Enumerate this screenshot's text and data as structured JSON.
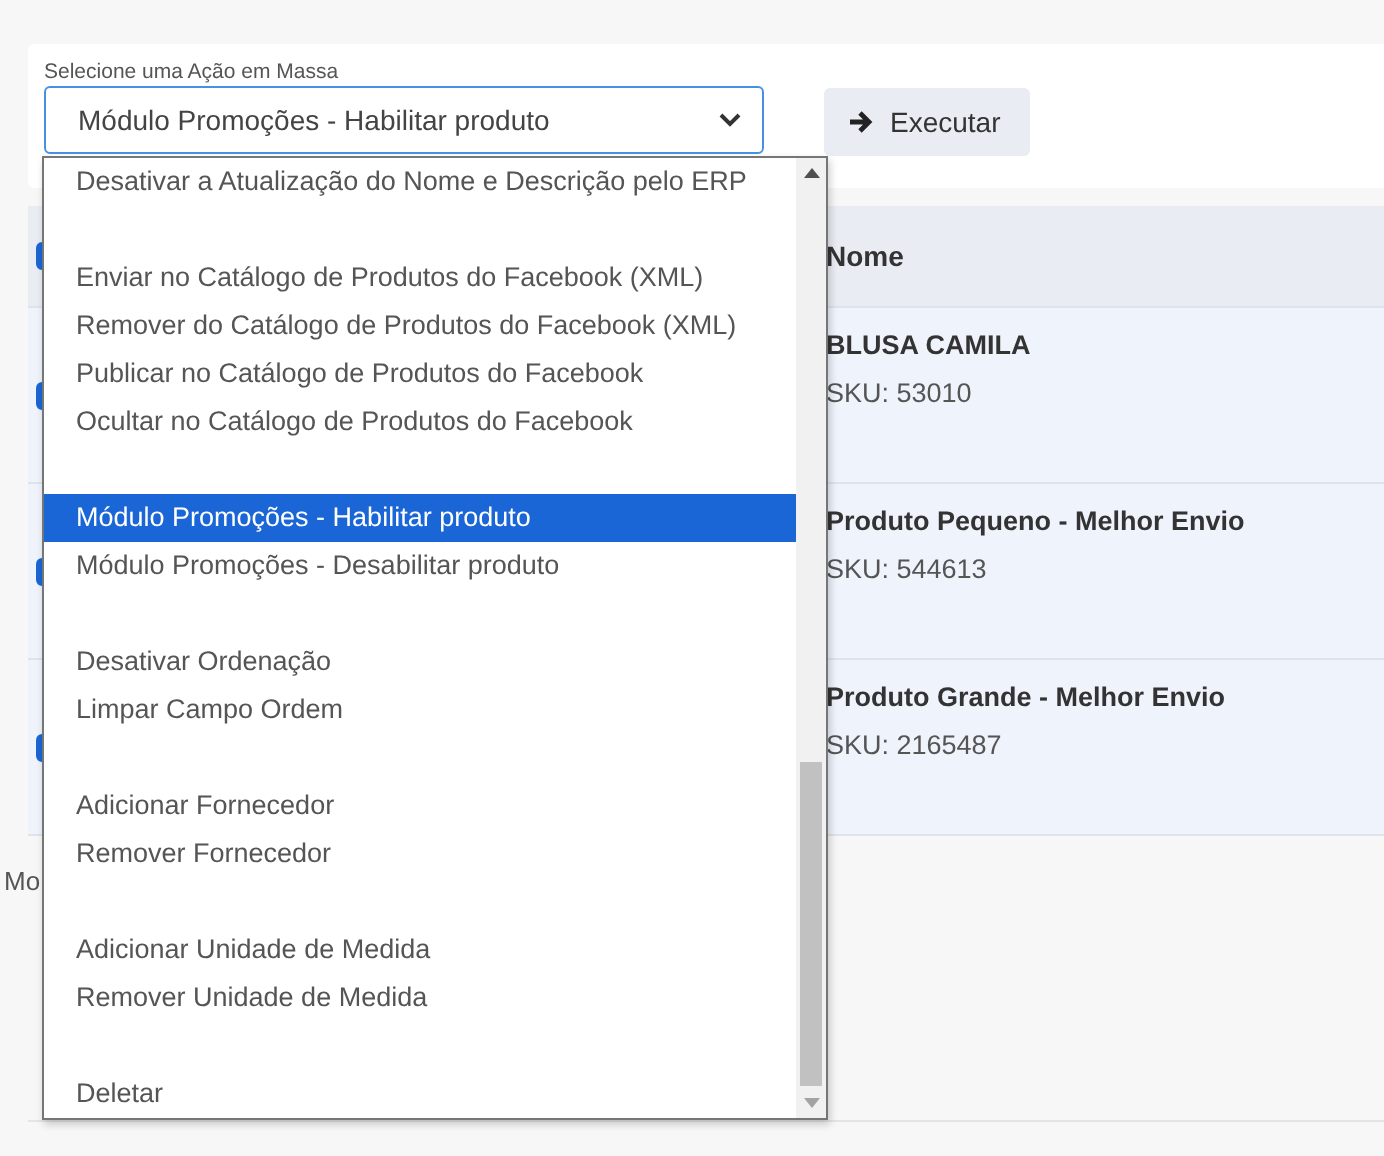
{
  "bulk_action": {
    "label": "Selecione uma Ação em Massa",
    "value": "Módulo Promoções - Habilitar produto",
    "execute_button": "Executar"
  },
  "table": {
    "header_checked": true,
    "columns": [
      "Nome"
    ],
    "rows": [
      {
        "checked": true,
        "name": "BLUSA CAMILA",
        "sku": "SKU: 53010"
      },
      {
        "checked": true,
        "name": "Produto Pequeno - Melhor Envio",
        "sku": "SKU: 544613"
      },
      {
        "checked": true,
        "name": "Produto Grande - Melhor Envio",
        "sku": "SKU: 2165487"
      }
    ]
  },
  "footer_text": "Mo",
  "dropdown": {
    "option_groups": [
      {
        "options": [
          {
            "label": "Desativar a Atualização do Nome e Descrição pelo ERP",
            "selected": false
          }
        ]
      },
      {
        "options": [
          {
            "label": "Enviar no Catálogo de Produtos do Facebook (XML)",
            "selected": false
          },
          {
            "label": "Remover do Catálogo de Produtos do Facebook (XML)",
            "selected": false
          },
          {
            "label": "Publicar no Catálogo de Produtos do Facebook",
            "selected": false
          },
          {
            "label": "Ocultar no Catálogo de Produtos do Facebook",
            "selected": false
          }
        ]
      },
      {
        "options": [
          {
            "label": "Módulo Promoções - Habilitar produto",
            "selected": true
          },
          {
            "label": "Módulo Promoções - Desabilitar produto",
            "selected": false
          }
        ]
      },
      {
        "options": [
          {
            "label": "Desativar Ordenação",
            "selected": false
          },
          {
            "label": "Limpar Campo Ordem",
            "selected": false
          }
        ]
      },
      {
        "options": [
          {
            "label": "Adicionar Fornecedor",
            "selected": false
          },
          {
            "label": "Remover Fornecedor",
            "selected": false
          }
        ]
      },
      {
        "options": [
          {
            "label": "Adicionar Unidade de Medida",
            "selected": false
          },
          {
            "label": "Remover Unidade de Medida",
            "selected": false
          }
        ]
      },
      {
        "options": [
          {
            "label": "Deletar",
            "selected": false
          }
        ]
      }
    ]
  }
}
